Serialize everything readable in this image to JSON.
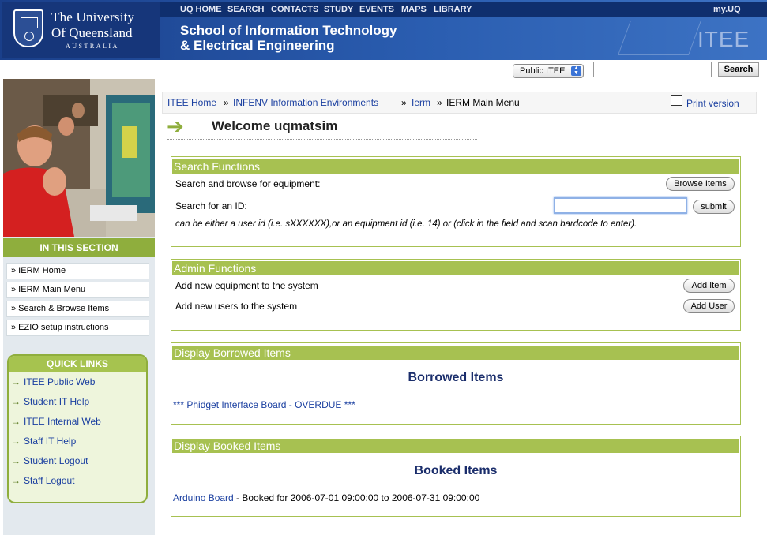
{
  "header": {
    "uq_name_line1": "The University",
    "uq_name_line2": "Of Queensland",
    "uq_name_line3": "AUSTRALIA",
    "nav": [
      "UQ HOME",
      "SEARCH",
      "CONTACTS",
      "STUDY",
      "EVENTS",
      "MAPS",
      "LIBRARY"
    ],
    "my_uq": "my.UQ",
    "school_line1": "School of Information Technology",
    "school_line2": "& Electrical Engineering",
    "brand": "ITEE"
  },
  "site_search": {
    "scope": "Public ITEE",
    "query": "",
    "button": "Search"
  },
  "sidebar": {
    "section_title": "IN THIS SECTION",
    "section_items": [
      "» IERM Home",
      "» IERM Main Menu",
      "» Search & Browse Items",
      "» EZIO setup instructions"
    ],
    "quick_links_title": "QUICK LINKS",
    "quick_links": [
      "ITEE Public Web",
      "Student IT Help",
      "ITEE Internal Web",
      "Staff IT Help",
      "Student Logout",
      "Staff Logout"
    ]
  },
  "breadcrumb": {
    "items": [
      "ITEE Home",
      "INFENV Information Environments",
      "Ierm"
    ],
    "separator": "»",
    "current": "IERM Main Menu"
  },
  "print_link": "Print version",
  "welcome": "Welcome uqmatsim",
  "search_functions": {
    "title": "Search Functions",
    "browse_label": "Search and browse for equipment:",
    "browse_button": "Browse Items",
    "id_label": "Search for an ID:",
    "id_value": "",
    "submit_button": "submit",
    "hint": "can be either a user id (i.e. sXXXXXX),or an equipment id (i.e. 14) or (click in the field and scan bardcode to enter)."
  },
  "admin_functions": {
    "title": "Admin Functions",
    "add_equipment_label": "Add new equipment to the system",
    "add_item_button": "Add Item",
    "add_users_label": "Add new users to the system",
    "add_user_button": "Add User"
  },
  "borrowed": {
    "title": "Display Borrowed Items",
    "heading": "Borrowed Items",
    "items": [
      "*** Phidget Interface Board - OVERDUE ***"
    ]
  },
  "booked": {
    "title": "Display Booked Items",
    "heading": "Booked Items",
    "items": [
      {
        "name": "Arduino Board",
        "details": " - Booked for 2006-07-01 09:00:00 to 2006-07-31 09:00:00"
      }
    ]
  },
  "colors": {
    "uq_blue": "#1a3f8a",
    "accent_green": "#a7c151",
    "link_blue": "#1a3fa0"
  }
}
